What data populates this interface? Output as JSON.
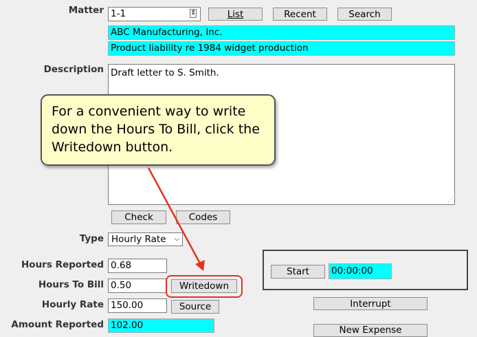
{
  "matter": {
    "label": "Matter",
    "value": "1-1",
    "list_button": "List",
    "recent_button": "Recent",
    "search_button": "Search",
    "client_name": "ABC Manufacturing, Inc.",
    "matter_desc": "Product liability re 1984 widget production"
  },
  "description": {
    "label": "Description",
    "text": "Draft letter to S. Smith.",
    "check_button": "Check",
    "codes_button": "Codes"
  },
  "type": {
    "label": "Type",
    "selected": "Hourly Rate"
  },
  "hours_reported": {
    "label": "Hours Reported",
    "value": "0.68"
  },
  "hours_to_bill": {
    "label": "Hours To Bill",
    "value": "0.50",
    "writedown_button": "Writedown"
  },
  "hourly_rate": {
    "label": "Hourly Rate",
    "value": "150.00",
    "source_button": "Source"
  },
  "amount_reported": {
    "label": "Amount Reported",
    "value": "102.00"
  },
  "timer": {
    "start_button": "Start",
    "elapsed": "00:00:00",
    "interrupt_button": "Interrupt",
    "new_expense_button": "New Expense"
  },
  "callout": {
    "text": "For a convenient way to write down the Hours To Bill, click the Writedown button."
  },
  "colors": {
    "highlight": "#00ffff",
    "annotation_red": "#e8301c",
    "callout_bg": "#fefdc8"
  }
}
